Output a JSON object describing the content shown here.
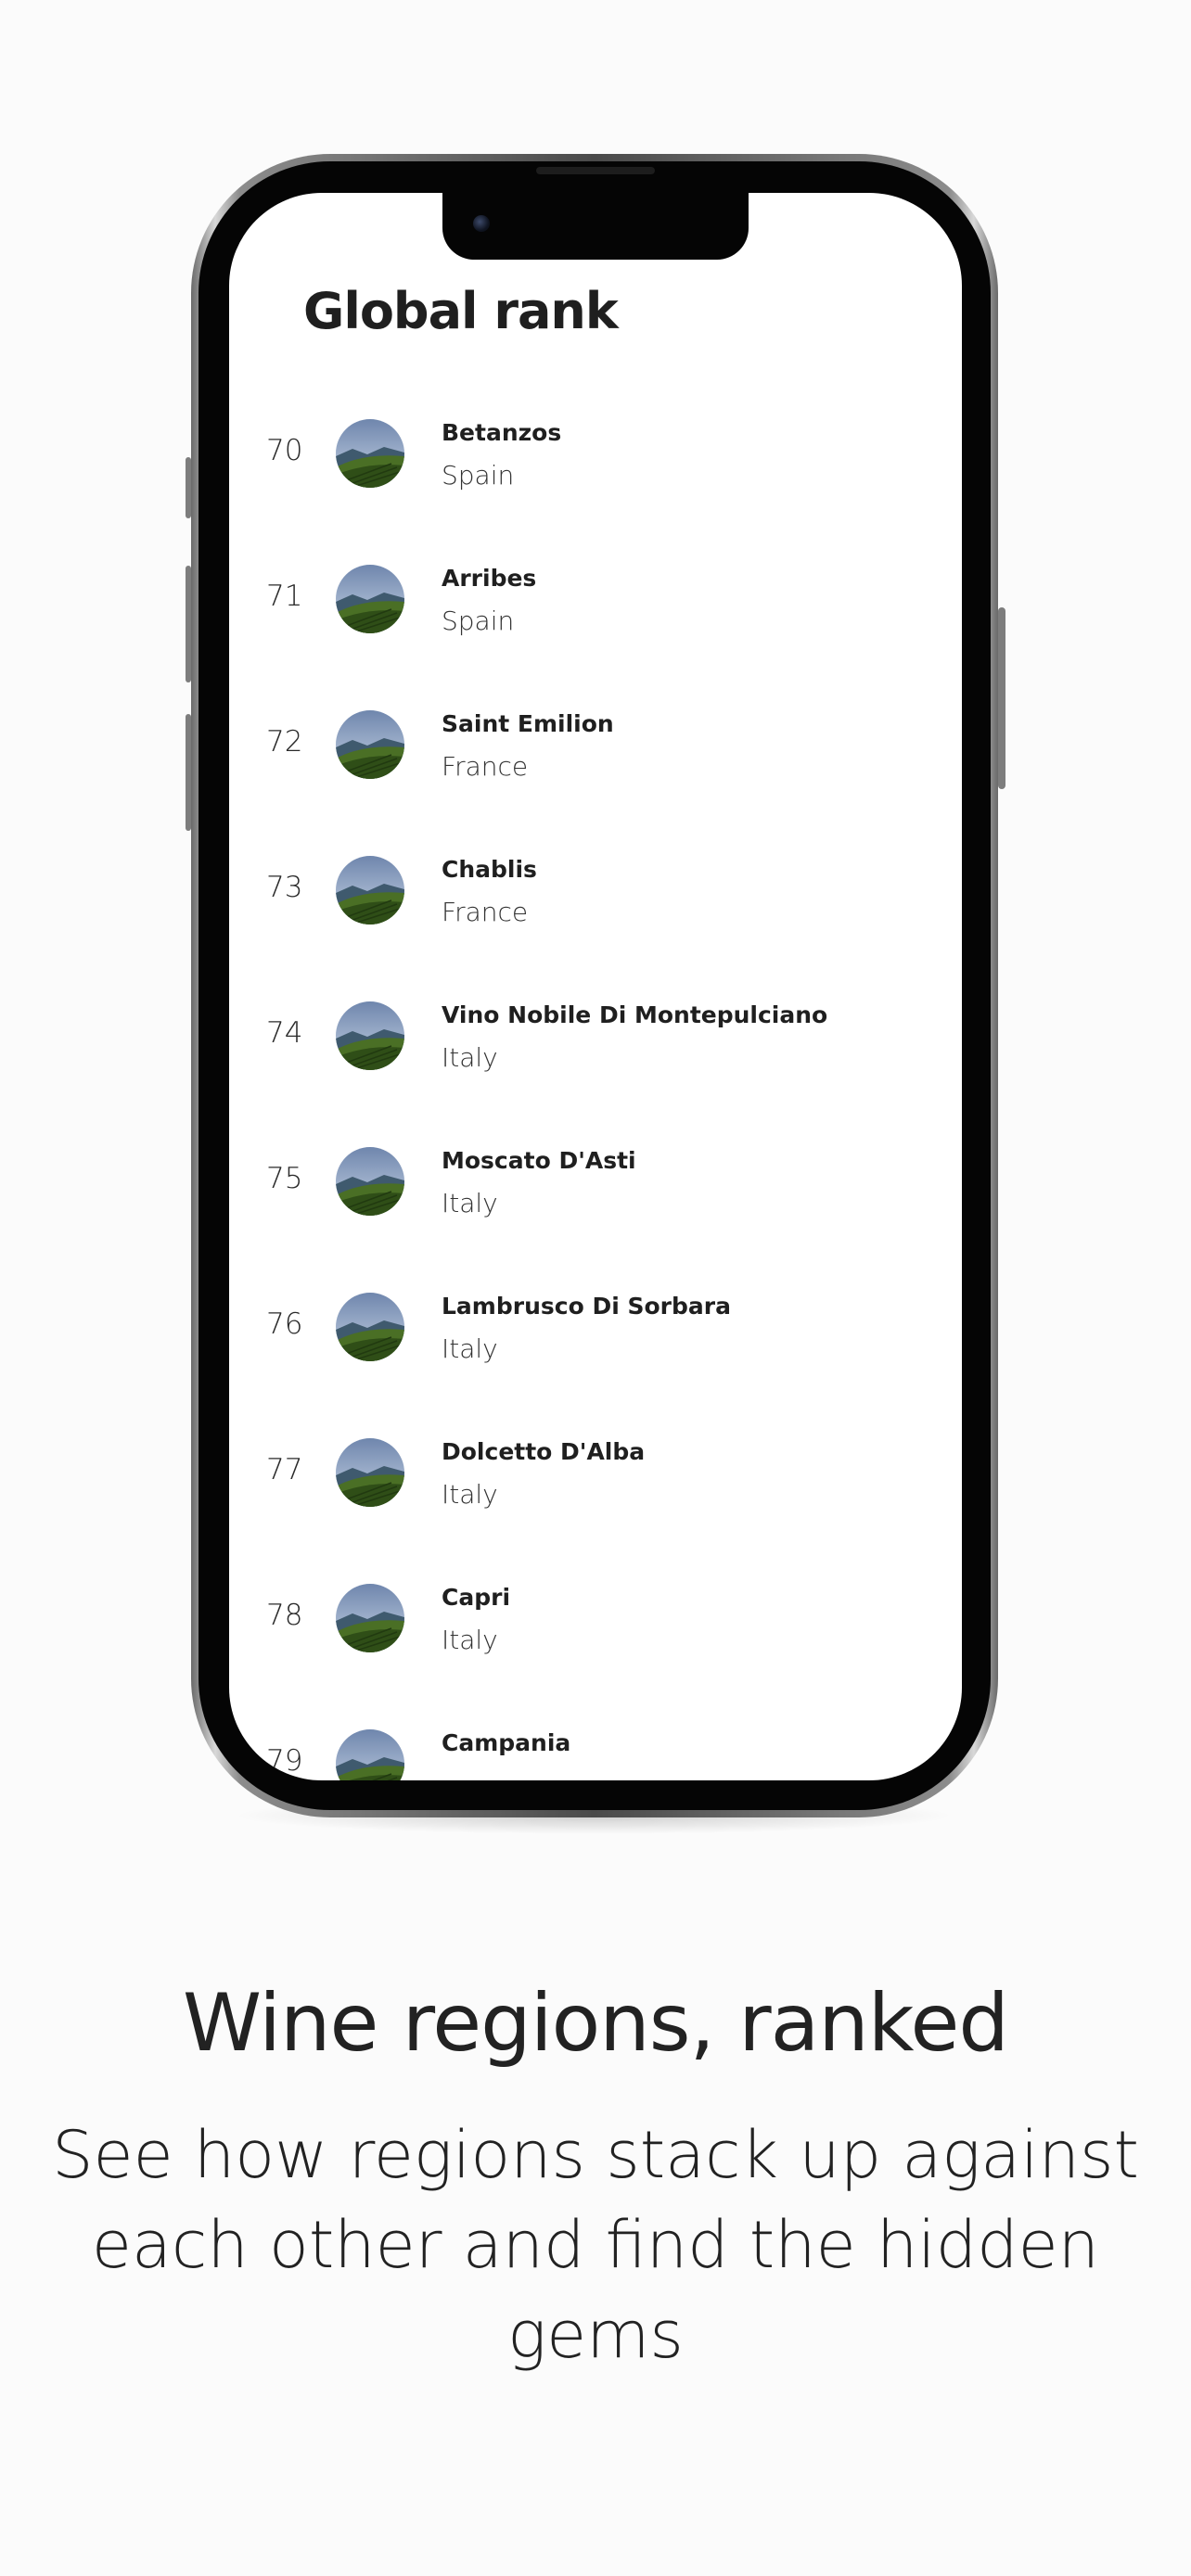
{
  "screen": {
    "title": "Global rank",
    "items": [
      {
        "rank": "70",
        "name": "Betanzos",
        "country": "Spain"
      },
      {
        "rank": "71",
        "name": "Arribes",
        "country": "Spain"
      },
      {
        "rank": "72",
        "name": "Saint Emilion",
        "country": "France"
      },
      {
        "rank": "73",
        "name": "Chablis",
        "country": "France"
      },
      {
        "rank": "74",
        "name": "Vino Nobile Di Montepulciano",
        "country": "Italy"
      },
      {
        "rank": "75",
        "name": "Moscato D'Asti",
        "country": "Italy"
      },
      {
        "rank": "76",
        "name": "Lambrusco Di Sorbara",
        "country": "Italy"
      },
      {
        "rank": "77",
        "name": "Dolcetto D'Alba",
        "country": "Italy"
      },
      {
        "rank": "78",
        "name": "Capri",
        "country": "Italy"
      },
      {
        "rank": "79",
        "name": "Campania",
        "country": ""
      }
    ]
  },
  "caption": {
    "headline": "Wine regions, ranked",
    "subline": "See how regions stack up against each other and find the hidden gems"
  },
  "icons": {
    "region_thumbnail": "vineyard-landscape-icon"
  }
}
